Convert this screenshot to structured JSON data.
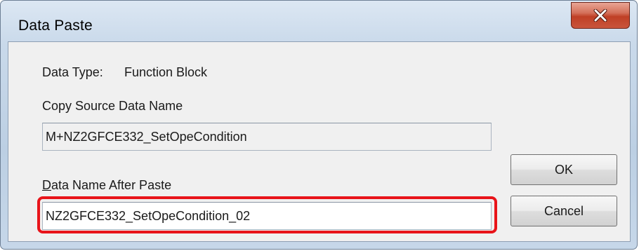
{
  "window": {
    "title": "Data Paste",
    "close_label": "close"
  },
  "form": {
    "data_type_label": "Data Type:",
    "data_type_value": "Function Block",
    "copy_source_label": "Copy Source Data Name",
    "copy_source_value": "M+NZ2GFCE332_SetOpeCondition",
    "after_paste_label_mnemonic": "D",
    "after_paste_label_rest": "ata Name After Paste",
    "after_paste_value": "NZ2GFCE332_SetOpeCondition_02"
  },
  "buttons": {
    "ok_label": "OK",
    "cancel_label": "Cancel"
  },
  "colors": {
    "highlight": "#e8141a",
    "close_button": "#c9553c"
  }
}
